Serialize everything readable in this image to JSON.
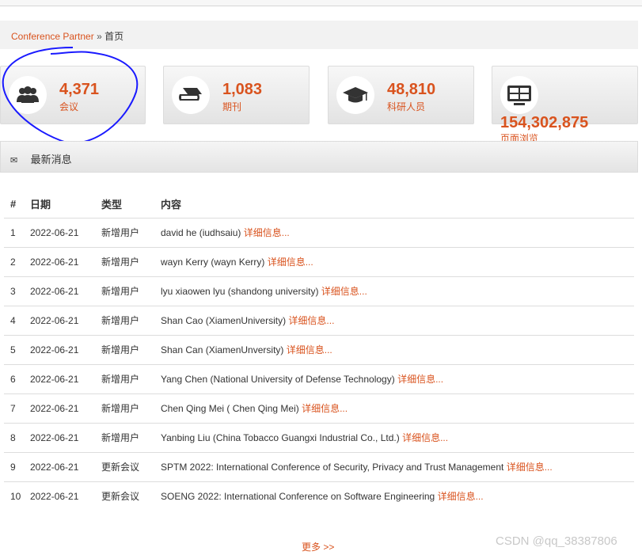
{
  "breadcrumb": {
    "site": "Conference Partner",
    "sep": "»",
    "home": "首页"
  },
  "stats": [
    {
      "icon": "users-icon",
      "value": "4,371",
      "label": "会议"
    },
    {
      "icon": "book-icon",
      "value": "1,083",
      "label": "期刊"
    },
    {
      "icon": "graduation-cap-icon",
      "value": "48,810",
      "label": "科研人员"
    },
    {
      "icon": "monitor-icon",
      "value": "154,302,875",
      "label": "页面浏览"
    }
  ],
  "news": {
    "title": "最新消息",
    "headers": [
      "#",
      "日期",
      "类型",
      "内容"
    ],
    "detail_label": "详细信息...",
    "rows": [
      {
        "n": "1",
        "date": "2022-06-21",
        "type": "新增用户",
        "content": "david he (iudhsaiu)"
      },
      {
        "n": "2",
        "date": "2022-06-21",
        "type": "新增用户",
        "content": "wayn Kerry (wayn Kerry)"
      },
      {
        "n": "3",
        "date": "2022-06-21",
        "type": "新增用户",
        "content": "lyu xiaowen lyu (shandong university)"
      },
      {
        "n": "4",
        "date": "2022-06-21",
        "type": "新增用户",
        "content": "Shan Cao (XiamenUniversity)"
      },
      {
        "n": "5",
        "date": "2022-06-21",
        "type": "新增用户",
        "content": "Shan Can (XiamenUnversity)"
      },
      {
        "n": "6",
        "date": "2022-06-21",
        "type": "新增用户",
        "content": "Yang Chen (National University of Defense Technology)"
      },
      {
        "n": "7",
        "date": "2022-06-21",
        "type": "新增用户",
        "content": "Chen Qing Mei ( Chen Qing Mei)"
      },
      {
        "n": "8",
        "date": "2022-06-21",
        "type": "新增用户",
        "content": "Yanbing Liu (China Tobacco Guangxi Industrial Co., Ltd.)"
      },
      {
        "n": "9",
        "date": "2022-06-21",
        "type": "更新会议",
        "content": "SPTM 2022: International Conference of Security, Privacy and Trust Management"
      },
      {
        "n": "10",
        "date": "2022-06-21",
        "type": "更新会议",
        "content": "SOENG 2022: International Conference on Software Engineering"
      }
    ],
    "more": "更多 >>"
  },
  "watermark": "CSDN @qq_38387806",
  "colors": {
    "accent": "#d9531e",
    "annotation": "#1a1aff"
  }
}
